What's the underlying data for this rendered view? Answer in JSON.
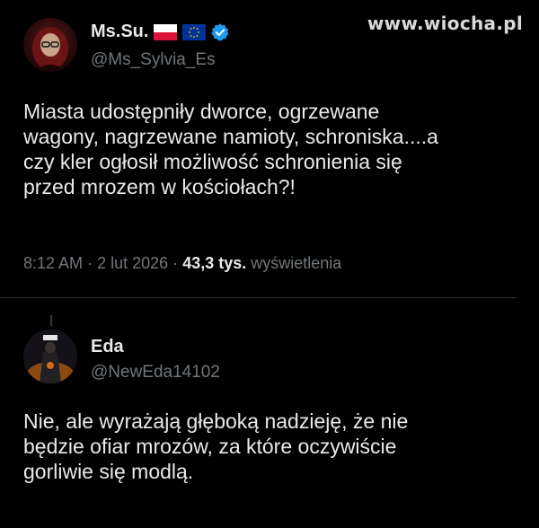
{
  "watermark": "www.wiocha.pl",
  "tweet": {
    "author": {
      "name": "Ms.Su.",
      "handle": "@Ms_Sylvia_Es",
      "badges": [
        "poland-flag-icon",
        "eu-flag-icon",
        "verified-icon"
      ]
    },
    "text_lines": [
      "Miasta udostępniły dworce, ogrzewane",
      "wagony, nagrzewane namioty, schroniska....a",
      "czy kler ogłosił możliwość schronienia się",
      "przed mrozem w kościołach?!"
    ],
    "time": "8:12 AM",
    "sep1": "·",
    "date": "2 lut 2026",
    "sep2": "·",
    "views": "43,3 tys.",
    "views_label": "wyświetlenia"
  },
  "reply": {
    "author": {
      "name": "Eda",
      "handle": "@NewEda14102"
    },
    "text_lines": [
      "Nie, ale wyrażają głęboką nadzieję, że nie",
      "będzie ofiar mrozów, za które oczywiście",
      "gorliwie się modlą."
    ]
  },
  "colors": {
    "background": "#000000",
    "text": "#e7e9ea",
    "secondary": "#71767b",
    "verified": "#1d9bf0",
    "divider": "#2f3336"
  }
}
